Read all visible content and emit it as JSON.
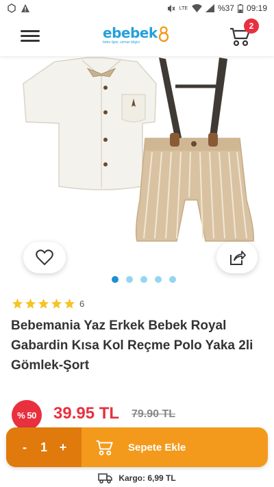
{
  "status_bar": {
    "time": "09:19",
    "battery": "%37",
    "network": "LTE"
  },
  "header": {
    "logo_text": "ebebek",
    "logo_tagline": "bebe ilgisi, uzman bilgisi",
    "cart_count": "2",
    "brand_color": "#26a0da"
  },
  "product": {
    "rating_stars": 5,
    "rating_count": "6",
    "title": "Bebemania Yaz Erkek Bebek Royal Gabardin Kısa Kol Reçme Polo Yaka 2li Gömlek-Şort",
    "discount": "% 50",
    "price": "39.95 TL",
    "old_price": "79.90 TL",
    "image_count": 5,
    "active_image_index": 0
  },
  "cart_bar": {
    "minus": "-",
    "quantity": "1",
    "plus": "+",
    "add_label": "Sepete Ekle"
  },
  "shipping": {
    "label": "Kargo: 6,99 TL"
  },
  "colors": {
    "accent_orange": "#f39a1c",
    "dark_orange": "#e07a0c",
    "sale_red": "#e8303e",
    "star_yellow": "#f7c325"
  }
}
